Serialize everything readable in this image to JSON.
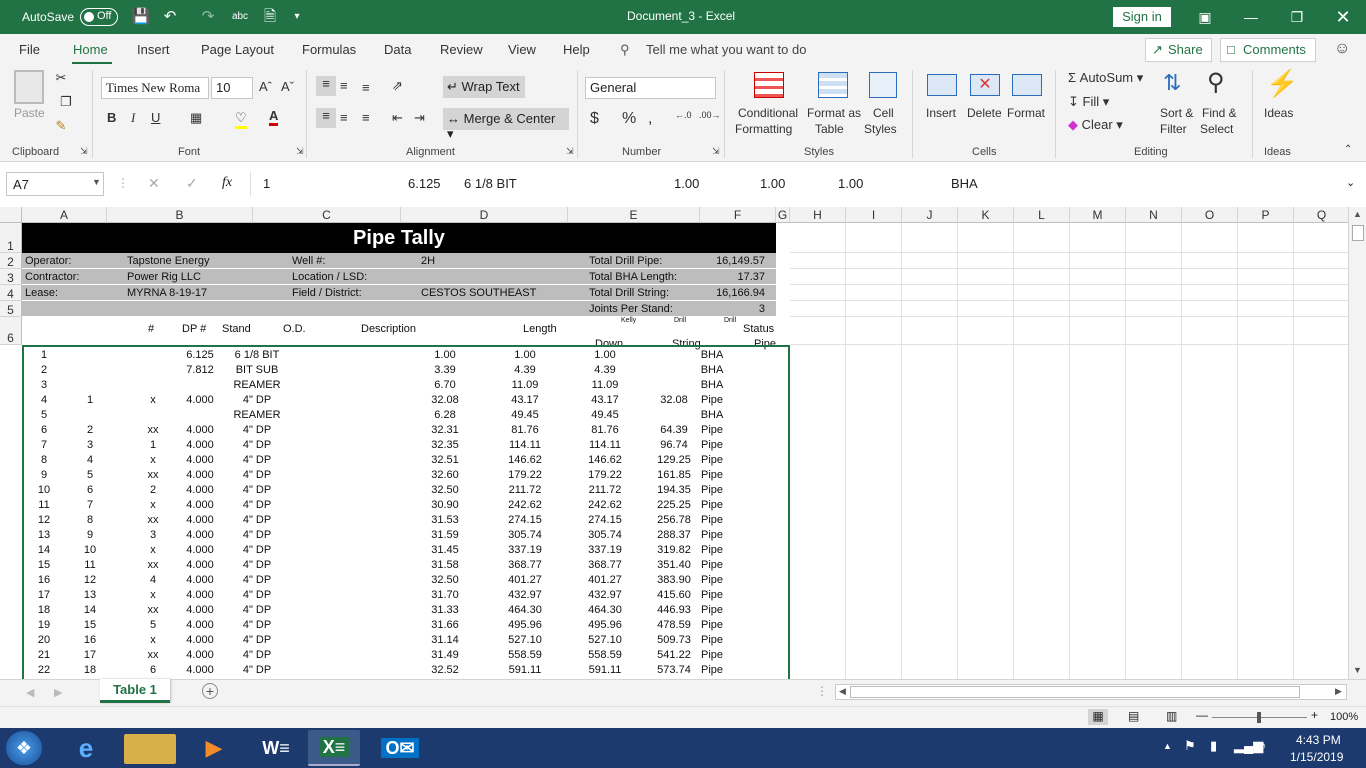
{
  "titlebar": {
    "autosave": "AutoSave",
    "toggle": "Off",
    "title": "Document_3  -  Excel",
    "signin": "Sign in"
  },
  "menu": {
    "items": [
      "File",
      "Home",
      "Insert",
      "Page Layout",
      "Formulas",
      "Data",
      "Review",
      "View",
      "Help"
    ],
    "tellme": "Tell me what you want to do",
    "share": "Share",
    "comments": "Comments"
  },
  "ribbon": {
    "clipboard": {
      "paste": "Paste",
      "label": "Clipboard"
    },
    "font": {
      "name": "Times New Roma",
      "size": "10",
      "label": "Font"
    },
    "alignment": {
      "wrap": "Wrap Text",
      "merge": "Merge & Center",
      "label": "Alignment"
    },
    "number": {
      "format": "General",
      "label": "Number"
    },
    "styles": {
      "cond1": "Conditional",
      "cond2": "Formatting",
      "fmt1": "Format as",
      "fmt2": "Table",
      "cell1": "Cell",
      "cell2": "Styles",
      "label": "Styles"
    },
    "cells": {
      "insert": "Insert",
      "delete": "Delete",
      "format": "Format",
      "label": "Cells"
    },
    "editing": {
      "autosum": "AutoSum",
      "fill": "Fill",
      "clear": "Clear",
      "sort1": "Sort &",
      "sort2": "Filter",
      "find1": "Find &",
      "find2": "Select",
      "label": "Editing"
    },
    "ideas": {
      "btn": "Ideas",
      "label": "Ideas"
    }
  },
  "formula_bar": {
    "namebox": "A7",
    "fx": "fx",
    "values": [
      "1",
      "6.125",
      "6 1/8 BIT",
      "1.00",
      "1.00",
      "1.00",
      "BHA"
    ]
  },
  "columns": [
    "A",
    "B",
    "C",
    "D",
    "E",
    "F",
    "G",
    "H",
    "I",
    "J",
    "K",
    "L",
    "M",
    "N",
    "O",
    "P",
    "Q"
  ],
  "sheet": {
    "title": "Pipe Tally",
    "info": [
      {
        "l1": "Operator:",
        "v1": "Tapstone Energy",
        "l2": "Well #:",
        "v2": "2H",
        "l3": "Total Drill Pipe:",
        "v3": "16,149.57"
      },
      {
        "l1": "Contractor:",
        "v1": "Power Rig LLC",
        "l2": "Location / LSD:",
        "v2": "",
        "l3": "Total BHA Length:",
        "v3": "17.37"
      },
      {
        "l1": "Lease:",
        "v1": "MYRNA 8-19-17",
        "l2": "Field / District:",
        "v2": "CESTOS SOUTHEAST",
        "l3": "Total Drill String:",
        "v3": "16,166.94"
      },
      {
        "l1": "",
        "v1": "",
        "l2": "",
        "v2": "",
        "l3": "Joints Per Stand:",
        "v3": "3"
      }
    ],
    "headers": {
      "num": "#",
      "dp": "DP #",
      "stand": "Stand",
      "od": "O.D.",
      "desc": "Description",
      "length": "Length",
      "kelly": "Kelly",
      "down": "Down",
      "drill1": "Drill",
      "string": "String",
      "drill2": "Drill",
      "status": "Status",
      "pipe": "Pipe"
    },
    "rows": [
      [
        "1",
        "",
        "",
        "6.125",
        "6 1/8 BIT",
        "1.00",
        "1.00",
        "1.00",
        "",
        "BHA"
      ],
      [
        "2",
        "",
        "",
        "7.812",
        "BIT SUB",
        "3.39",
        "4.39",
        "4.39",
        "",
        "BHA"
      ],
      [
        "3",
        "",
        "",
        "",
        "REAMER",
        "6.70",
        "11.09",
        "11.09",
        "",
        "BHA"
      ],
      [
        "4",
        "1",
        "x",
        "4.000",
        "4\" DP",
        "32.08",
        "43.17",
        "43.17",
        "32.08",
        "Pipe"
      ],
      [
        "5",
        "",
        "",
        "",
        "REAMER",
        "6.28",
        "49.45",
        "49.45",
        "",
        "BHA"
      ],
      [
        "6",
        "2",
        "xx",
        "4.000",
        "4\" DP",
        "32.31",
        "81.76",
        "81.76",
        "64.39",
        "Pipe"
      ],
      [
        "7",
        "3",
        "1",
        "4.000",
        "4\" DP",
        "32.35",
        "114.11",
        "114.11",
        "96.74",
        "Pipe"
      ],
      [
        "8",
        "4",
        "x",
        "4.000",
        "4\" DP",
        "32.51",
        "146.62",
        "146.62",
        "129.25",
        "Pipe"
      ],
      [
        "9",
        "5",
        "xx",
        "4.000",
        "4\" DP",
        "32.60",
        "179.22",
        "179.22",
        "161.85",
        "Pipe"
      ],
      [
        "10",
        "6",
        "2",
        "4.000",
        "4\" DP",
        "32.50",
        "211.72",
        "211.72",
        "194.35",
        "Pipe"
      ],
      [
        "11",
        "7",
        "x",
        "4.000",
        "4\" DP",
        "30.90",
        "242.62",
        "242.62",
        "225.25",
        "Pipe"
      ],
      [
        "12",
        "8",
        "xx",
        "4.000",
        "4\" DP",
        "31.53",
        "274.15",
        "274.15",
        "256.78",
        "Pipe"
      ],
      [
        "13",
        "9",
        "3",
        "4.000",
        "4\" DP",
        "31.59",
        "305.74",
        "305.74",
        "288.37",
        "Pipe"
      ],
      [
        "14",
        "10",
        "x",
        "4.000",
        "4\" DP",
        "31.45",
        "337.19",
        "337.19",
        "319.82",
        "Pipe"
      ],
      [
        "15",
        "11",
        "xx",
        "4.000",
        "4\" DP",
        "31.58",
        "368.77",
        "368.77",
        "351.40",
        "Pipe"
      ],
      [
        "16",
        "12",
        "4",
        "4.000",
        "4\" DP",
        "32.50",
        "401.27",
        "401.27",
        "383.90",
        "Pipe"
      ],
      [
        "17",
        "13",
        "x",
        "4.000",
        "4\" DP",
        "31.70",
        "432.97",
        "432.97",
        "415.60",
        "Pipe"
      ],
      [
        "18",
        "14",
        "xx",
        "4.000",
        "4\" DP",
        "31.33",
        "464.30",
        "464.30",
        "446.93",
        "Pipe"
      ],
      [
        "19",
        "15",
        "5",
        "4.000",
        "4\" DP",
        "31.66",
        "495.96",
        "495.96",
        "478.59",
        "Pipe"
      ],
      [
        "20",
        "16",
        "x",
        "4.000",
        "4\" DP",
        "31.14",
        "527.10",
        "527.10",
        "509.73",
        "Pipe"
      ],
      [
        "21",
        "17",
        "xx",
        "4.000",
        "4\" DP",
        "31.49",
        "558.59",
        "558.59",
        "541.22",
        "Pipe"
      ],
      [
        "22",
        "18",
        "6",
        "4.000",
        "4\" DP",
        "32.52",
        "591.11",
        "591.11",
        "573.74",
        "Pipe"
      ]
    ]
  },
  "tabs": {
    "active": "Table 1"
  },
  "status": {
    "zoom": "100%"
  },
  "taskbar": {
    "time": "4:43 PM",
    "date": "1/15/2019"
  }
}
